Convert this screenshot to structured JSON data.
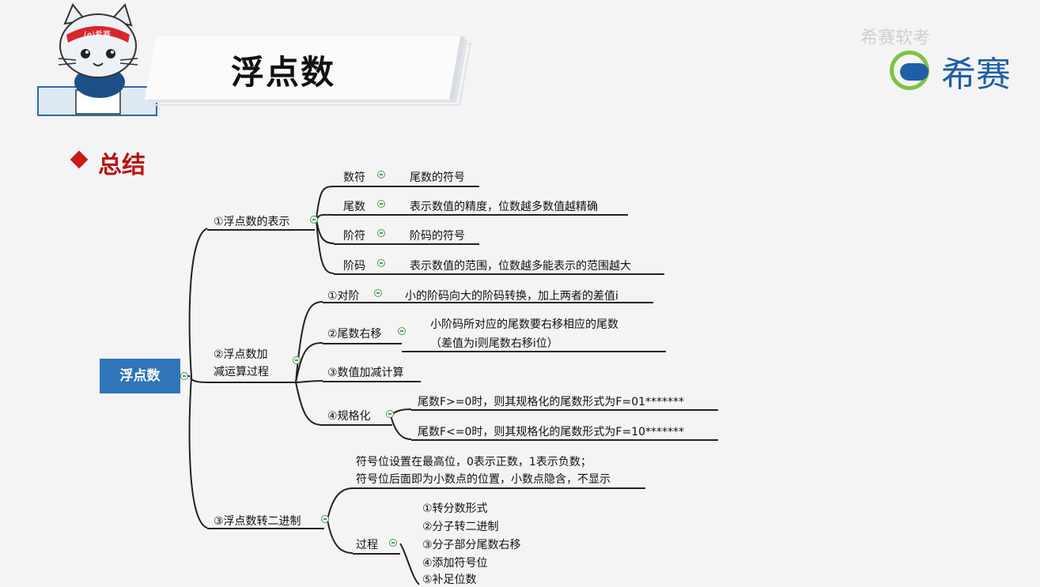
{
  "header": {
    "title": "浮点数",
    "watermark": "希赛软考",
    "logo": "希赛"
  },
  "section": {
    "title": "总结"
  },
  "mindmap": {
    "root": "浮点数",
    "branch1": {
      "label": "①浮点数的表示",
      "items": [
        {
          "label": "数符",
          "desc": "尾数的符号"
        },
        {
          "label": "尾数",
          "desc": "表示数值的精度，位数越多数值越精确"
        },
        {
          "label": "阶符",
          "desc": "阶码的符号"
        },
        {
          "label": "阶码",
          "desc": "表示数值的范围，位数越多能表示的范围越大"
        }
      ]
    },
    "branch2": {
      "label_line1": "②浮点数加",
      "label_line2": "减运算过程",
      "items": [
        {
          "label": "①对阶",
          "desc": "小的阶码向大的阶码转换，加上两者的差值i"
        },
        {
          "label": "②尾数右移",
          "desc_line1": "小阶码所对应的尾数要右移相应的尾数",
          "desc_line2": "（差值为i则尾数右移i位）"
        },
        {
          "label": "③数值加减计算"
        },
        {
          "label": "④规格化",
          "desc1": "尾数F>=0时，则其规格化的尾数形式为F=01*******",
          "desc2": "尾数F<=0时，则其规格化的尾数形式为F=10*******"
        }
      ]
    },
    "branch3": {
      "label": "③浮点数转二进制",
      "note_line1": "符号位设置在最高位，0表示正数，1表示负数；",
      "note_line2": "符号位后面即为小数点的位置，小数点隐含，不显示",
      "process_label": "过程",
      "steps": [
        "①转分数形式",
        "②分子转二进制",
        "③分子部分尾数右移",
        "④添加符号位",
        "⑤补足位数"
      ]
    }
  },
  "colors": {
    "root_bg": "#2f75b8",
    "accent_red": "#c61b1b",
    "collapse_icon": "#4a9f57",
    "logo_blue": "#1f5fa5",
    "logo_green": "#7fc244"
  }
}
